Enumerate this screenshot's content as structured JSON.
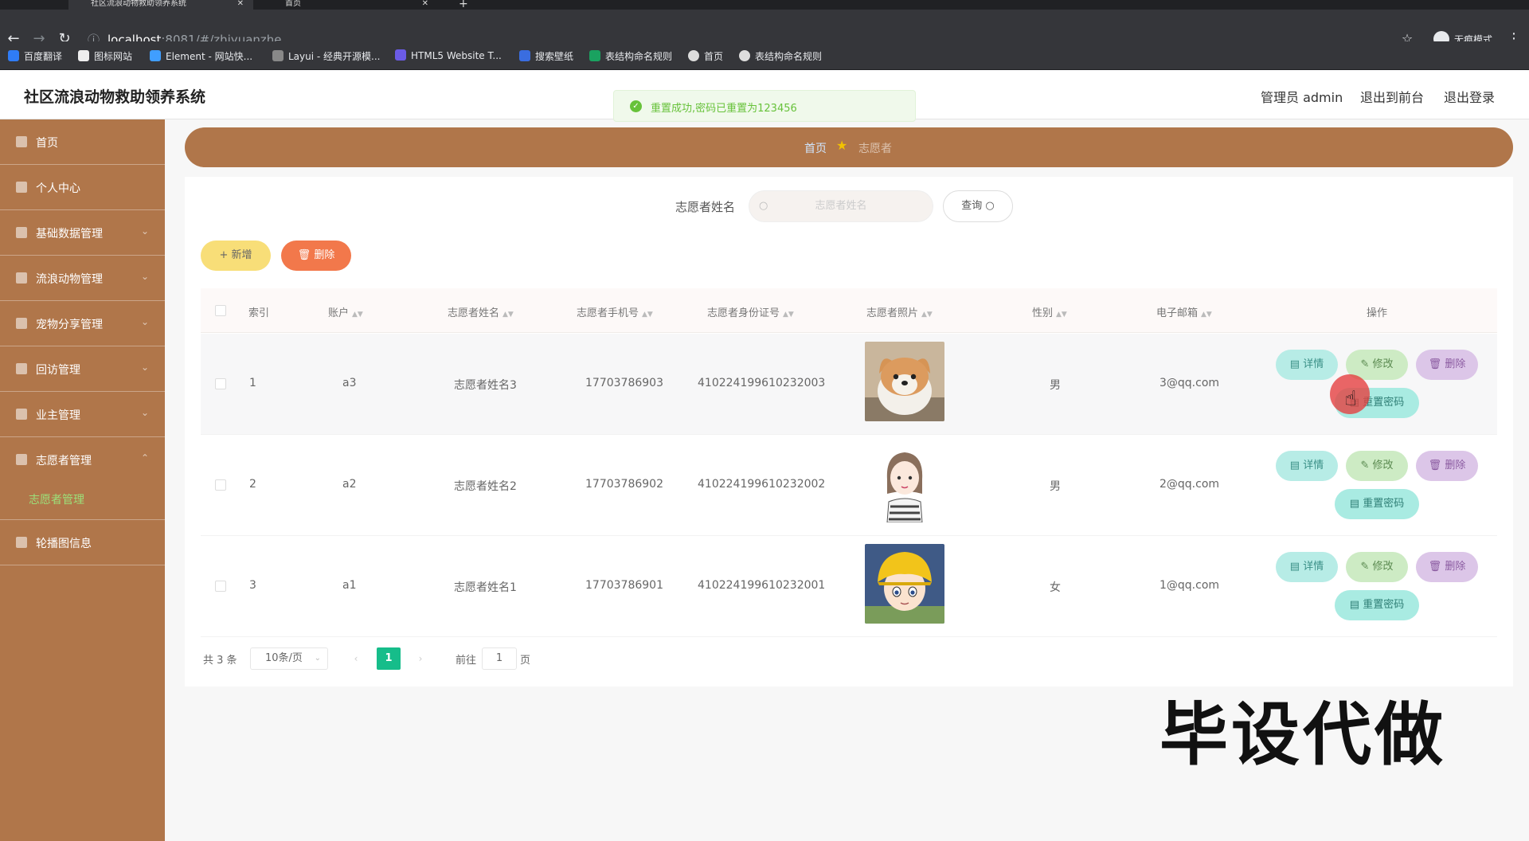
{
  "browser": {
    "tabs": [
      {
        "title": "社区流浪动物救助领养系统"
      },
      {
        "title": "首页"
      }
    ],
    "url_host": "localhost",
    "url_rest": ":8081/#/zhiyuanzhe",
    "incognito_label": "无痕模式",
    "bookmarks": [
      "百度翻译",
      "图标网站",
      "Element - 网站快...",
      "Layui - 经典开源模...",
      "HTML5 Website T...",
      "搜索壁纸",
      "表结构命名规则",
      "首页",
      "表结构命名规则"
    ]
  },
  "header": {
    "title": "社区流浪动物救助领养系统",
    "admin": "管理员 admin",
    "to_front": "退出到前台",
    "logout": "退出登录"
  },
  "toast": {
    "message": "重置成功,密码已重置为123456"
  },
  "sidebar": {
    "items": [
      {
        "label": "首页"
      },
      {
        "label": "个人中心"
      },
      {
        "label": "基础数据管理"
      },
      {
        "label": "流浪动物管理"
      },
      {
        "label": "宠物分享管理"
      },
      {
        "label": "回访管理"
      },
      {
        "label": "业主管理"
      },
      {
        "label": "志愿者管理"
      },
      {
        "label": "轮播图信息"
      }
    ],
    "sub_item": "志愿者管理"
  },
  "breadcrumb": {
    "home": "首页",
    "current": "志愿者"
  },
  "search": {
    "label": "志愿者姓名",
    "placeholder": "志愿者姓名",
    "button": "查询"
  },
  "actions": {
    "add": "新增",
    "delete": "删除"
  },
  "table": {
    "columns": [
      "索引",
      "账户",
      "志愿者姓名",
      "志愿者手机号",
      "志愿者身份证号",
      "志愿者照片",
      "性别",
      "电子邮箱",
      "操作"
    ],
    "rows": [
      {
        "index": "1",
        "account": "a3",
        "name": "志愿者姓名3",
        "phone": "17703786903",
        "id_number": "410224199610232003",
        "gender": "男",
        "email": "3@qq.com"
      },
      {
        "index": "2",
        "account": "a2",
        "name": "志愿者姓名2",
        "phone": "17703786902",
        "id_number": "410224199610232002",
        "gender": "男",
        "email": "2@qq.com"
      },
      {
        "index": "3",
        "account": "a1",
        "name": "志愿者姓名1",
        "phone": "17703786901",
        "id_number": "410224199610232001",
        "gender": "女",
        "email": "1@qq.com"
      }
    ],
    "ops": {
      "detail": "详情",
      "edit": "修改",
      "delete": "删除",
      "reset": "重置密码"
    }
  },
  "pagination": {
    "total": "共 3 条",
    "page_size": "10条/页",
    "current": "1",
    "goto_prefix": "前往",
    "goto_value": "1",
    "goto_suffix": "页"
  },
  "watermark": "毕设代做"
}
